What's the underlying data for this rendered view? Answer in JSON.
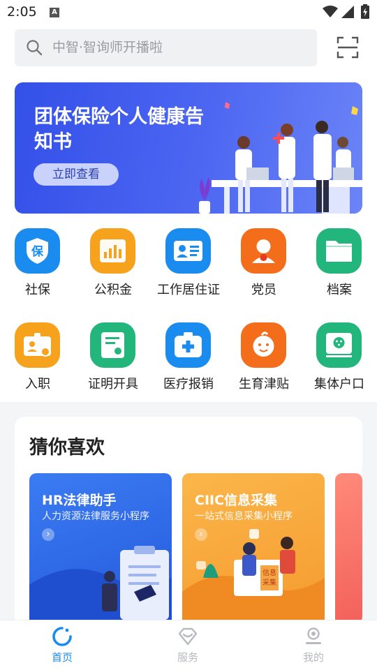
{
  "status_bar": {
    "time": "2:05",
    "notification_glyph": "A"
  },
  "search": {
    "placeholder": "中智·智询师开播啦"
  },
  "banner": {
    "title": "团体保险个人健康告知书",
    "button_label": "立即查看"
  },
  "services": [
    {
      "label": "社保",
      "icon": "shield-bao-icon",
      "color": "#1a8cf0",
      "glyph": "保"
    },
    {
      "label": "公积金",
      "icon": "chart-bars-icon",
      "color": "#f7a21c"
    },
    {
      "label": "工作居住证",
      "icon": "id-card-icon",
      "color": "#1a8cf0"
    },
    {
      "label": "党员",
      "icon": "party-member-icon",
      "color": "#f36d1a"
    },
    {
      "label": "档案",
      "icon": "folder-icon",
      "color": "#22b57c"
    },
    {
      "label": "入职",
      "icon": "badge-onboard-icon",
      "color": "#f7a21c"
    },
    {
      "label": "证明开具",
      "icon": "certificate-icon",
      "color": "#22b57c"
    },
    {
      "label": "医疗报销",
      "icon": "medical-kit-icon",
      "color": "#1a8cf0"
    },
    {
      "label": "生育津贴",
      "icon": "baby-face-icon",
      "color": "#f36d1a"
    },
    {
      "label": "集体户口",
      "icon": "household-register-icon",
      "color": "#22b57c"
    }
  ],
  "recommend": {
    "title": "猜你喜欢",
    "cards": [
      {
        "title": "HR法律助手",
        "subtitle": "人力资源法律服务小程序",
        "color": "#2f6be8"
      },
      {
        "title": "CIIC信息采集",
        "subtitle": "一站式信息采集小程序",
        "color": "#f7a83a",
        "illus_text_1": "信息",
        "illus_text_2": "采集"
      }
    ]
  },
  "tabbar": {
    "items": [
      {
        "label": "首页",
        "icon": "home-logo-icon",
        "active": true
      },
      {
        "label": "服务",
        "icon": "diamond-service-icon",
        "active": false
      },
      {
        "label": "我的",
        "icon": "profile-icon",
        "active": false
      }
    ],
    "active_color": "#1a8cf0",
    "inactive_color": "#b6b9bf"
  }
}
